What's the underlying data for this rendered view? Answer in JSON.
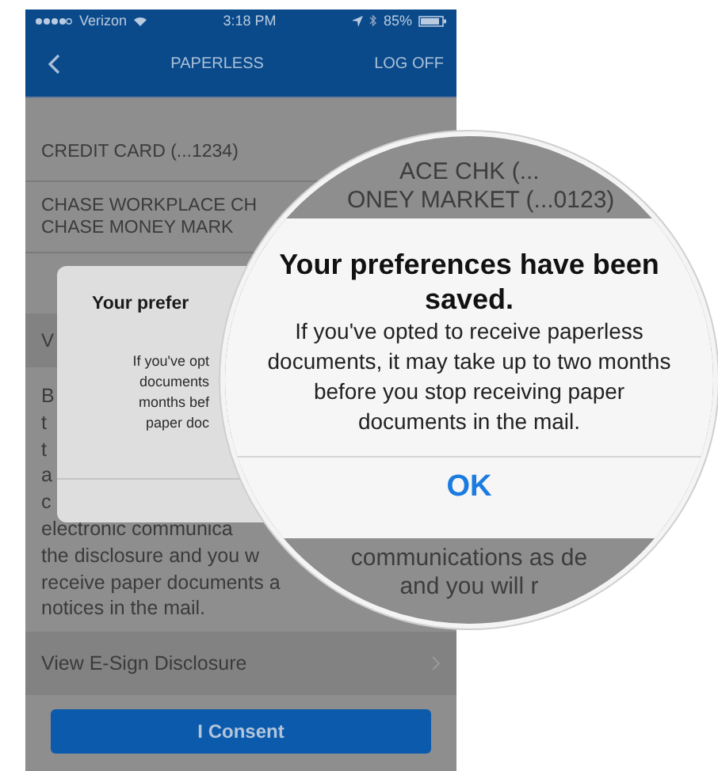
{
  "status_bar": {
    "carrier": "Verizon",
    "time": "3:18 PM",
    "battery": "85%"
  },
  "nav": {
    "title": "PAPERLESS",
    "action": "LOG OFF"
  },
  "accounts": [
    {
      "lines": [
        "CREDIT CARD (...1234)"
      ]
    },
    {
      "lines": [
        "CHASE WORKPLACE CH",
        "CHASE MONEY MARK"
      ]
    }
  ],
  "section_row": "V",
  "body_lines": [
    "B",
    "t",
    "t",
    "a",
    "c",
    "electronic communica",
    "the disclosure and you w",
    "receive paper documents a",
    "notices in the mail."
  ],
  "link_row": "View E-Sign Disclosure",
  "consent_button": "I Consent",
  "dialog": {
    "title": "Your prefer",
    "body_lines": [
      "If you've opt",
      "documents",
      "months bef",
      "paper doc"
    ]
  },
  "magnifier": {
    "top_lines": [
      "ACE CHK (...",
      "ONEY MARKET (...0123)"
    ],
    "dialog": {
      "title": "Your preferences have been saved.",
      "message": "If you've opted to receive paperless documents, it may take up to two months before you stop receiving paper documents in the mail.",
      "button": "OK"
    },
    "bottom_lines": [
      "communications as de",
      "and you will r"
    ]
  }
}
